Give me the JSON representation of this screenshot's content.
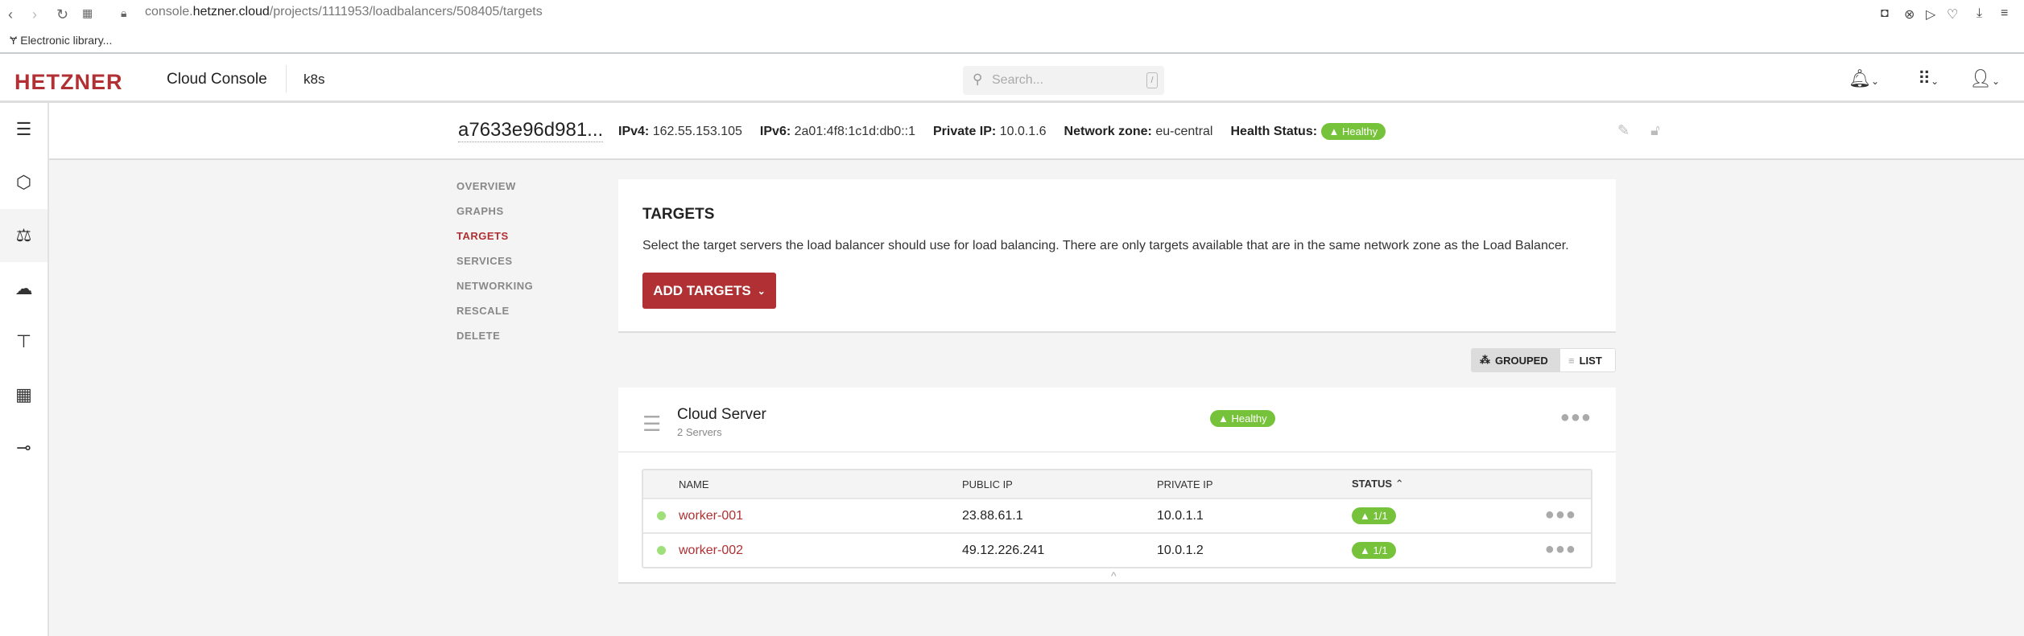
{
  "browser": {
    "url_prefix": "console.",
    "url_domain": "hetzner.cloud",
    "url_path": "/projects/1111953/loadbalancers/508405/targets",
    "bookmark": "Electronic library..."
  },
  "header": {
    "logo": "HETZNER",
    "app": "Cloud Console",
    "project": "k8s",
    "search_placeholder": "Search...",
    "search_key": "/"
  },
  "lb": {
    "name": "a7633e96d981...",
    "ipv4_label": "IPv4:",
    "ipv4": "162.55.153.105",
    "ipv6_label": "IPv6:",
    "ipv6": "2a01:4f8:1c1d:db0::1",
    "private_label": "Private IP:",
    "private_ip": "10.0.1.6",
    "zone_label": "Network zone:",
    "zone": "eu-central",
    "health_label": "Health Status:",
    "health": "Healthy"
  },
  "submenu": [
    "OVERVIEW",
    "GRAPHS",
    "TARGETS",
    "SERVICES",
    "NETWORKING",
    "RESCALE",
    "DELETE"
  ],
  "targets": {
    "title": "TARGETS",
    "desc": "Select the target servers the load balancer should use for load balancing. There are only targets available that are in the same network zone as the Load Balancer.",
    "add": "ADD TARGETS"
  },
  "view": {
    "grouped": "GROUPED",
    "list": "LIST"
  },
  "group": {
    "title": "Cloud Server",
    "subtitle": "2 Servers",
    "health": "Healthy"
  },
  "table": {
    "headers": [
      "NAME",
      "PUBLIC IP",
      "PRIVATE IP",
      "STATUS"
    ],
    "rows": [
      {
        "name": "worker-001",
        "public": "23.88.61.1",
        "private": "10.0.1.1",
        "status": "1/1"
      },
      {
        "name": "worker-002",
        "public": "49.12.226.241",
        "private": "10.0.1.2",
        "status": "1/1"
      }
    ]
  },
  "colors": {
    "brand": "#b03033",
    "healthy": "#77c23b"
  }
}
